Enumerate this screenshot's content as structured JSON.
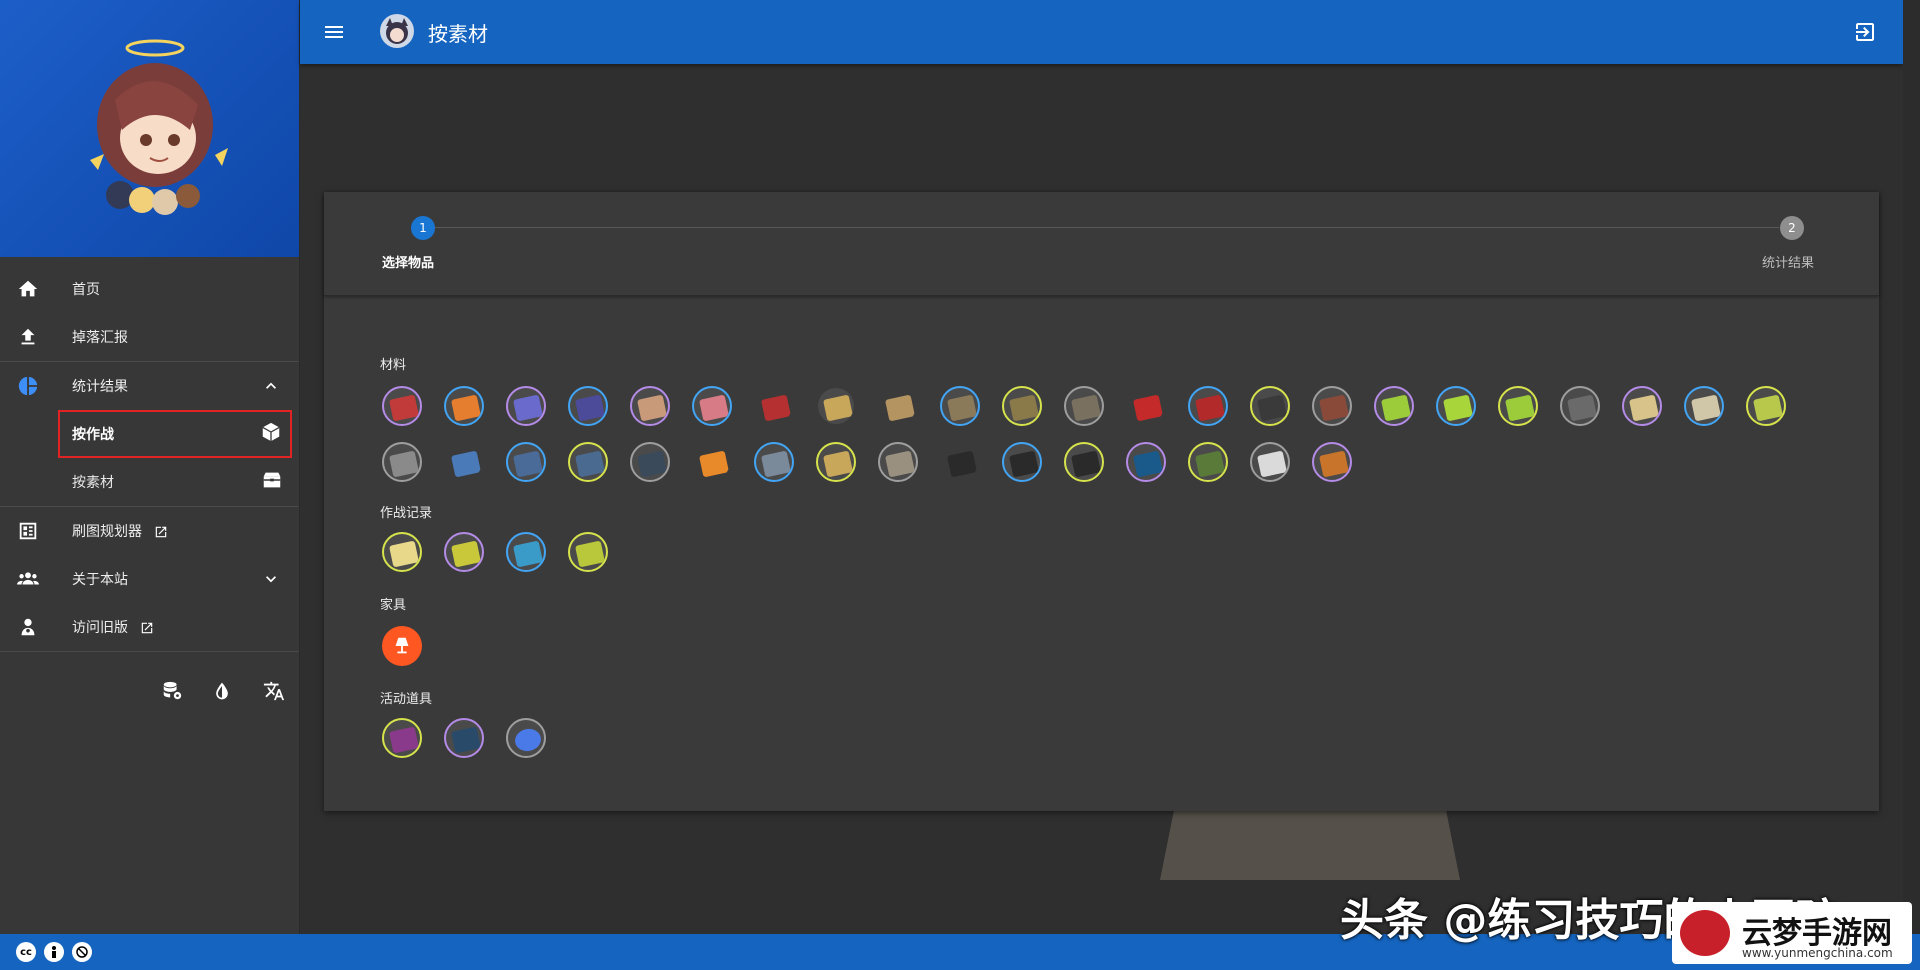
{
  "topbar": {
    "title": "按素材"
  },
  "sidebar": {
    "nav": [
      {
        "label": "首页",
        "icon": "home-icon"
      },
      {
        "label": "掉落汇报",
        "icon": "upload-icon"
      },
      {
        "label": "统计结果",
        "icon": "pie-chart-icon"
      },
      {
        "label": "刷图规划器",
        "icon": "planner-icon"
      },
      {
        "label": "关于本站",
        "icon": "people-icon"
      },
      {
        "label": "访问旧版",
        "icon": "person-icon"
      }
    ],
    "sub": [
      {
        "label": "按作战",
        "icon": "cube-icon"
      },
      {
        "label": "按素材",
        "icon": "treasure-chest-icon"
      }
    ]
  },
  "stepper": {
    "steps": [
      {
        "num": "1",
        "label": "选择物品"
      },
      {
        "num": "2",
        "label": "统计结果"
      }
    ]
  },
  "sections": {
    "materials": "材料",
    "records": "作战记录",
    "furniture": "家具",
    "event": "活动道具"
  },
  "colors": {
    "accent": "#1565c0",
    "highlight": "#e02424",
    "furniture": "#ff5722"
  },
  "watermark": {
    "main": "头条 @练习技巧的小写孩",
    "site": "云梦手游网",
    "url": "www.yunmengchina.com"
  }
}
